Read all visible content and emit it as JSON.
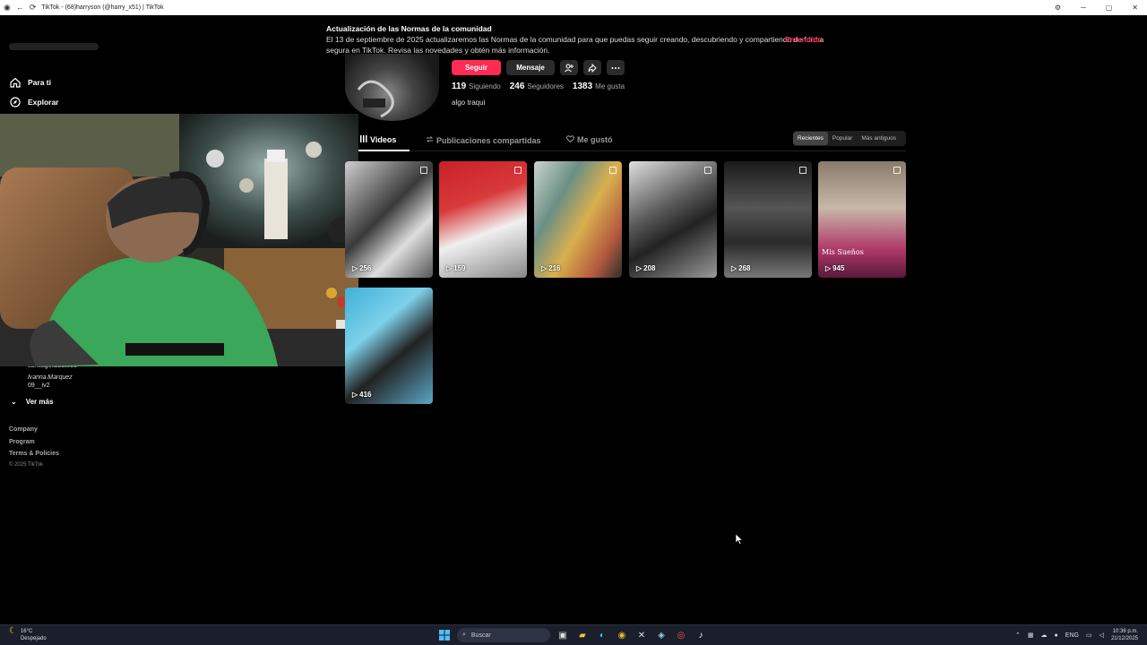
{
  "window": {
    "title": "TikTok - (68)harryson (@harry_x51) | TikTok",
    "nav_back": "←",
    "nav_reload": "⟳",
    "controls": [
      "⚙",
      "─",
      "▢",
      "✕"
    ]
  },
  "banner": {
    "title": "Actualización de las Normas de la comunidad",
    "text": "El 13 de septiembre de 2025 actualizaremos las Normas de la comunidad para que puedas seguir creando, descubriendo y compartiendo de forma segura en TikTok. Revisa las novedades y obtén más información.",
    "ok_label": "Entendido"
  },
  "sidebar": {
    "items": [
      {
        "label": "Para ti",
        "icon": "home-icon"
      },
      {
        "label": "Explorar",
        "icon": "compass-icon"
      }
    ],
    "following": [
      "santiago.alzate83",
      "𝐼𝑣𝑎𝑛𝑛𝑎 𝑀𝑎𝑟𝑞𝑢𝑒𝑧",
      "09__iv2"
    ],
    "more_label": "Ver más",
    "footer_links": [
      "Company",
      "Program",
      "Terms & Policies"
    ],
    "copyright": "© 2025 TikTok"
  },
  "profile": {
    "follow_label": "Seguir",
    "message_label": "Mensaje",
    "following_count": "119",
    "following_label": "Siguiendo",
    "followers_count": "246",
    "followers_label": "Seguidores",
    "likes_count": "1383",
    "likes_label": "Me gusta",
    "bio": "algo traqui"
  },
  "tabs": [
    {
      "label": "Videos",
      "icon": "grid-icon"
    },
    {
      "label": "Publicaciones compartidas",
      "icon": "repost-icon"
    },
    {
      "label": "Me gustó",
      "icon": "heart-icon"
    }
  ],
  "sort": [
    "Recientes",
    "Popular",
    "Más antiguos"
  ],
  "videos": [
    {
      "views": "256"
    },
    {
      "views": "159"
    },
    {
      "views": "216"
    },
    {
      "views": "208"
    },
    {
      "views": "268"
    },
    {
      "views": "945",
      "caption": "Mis Sueños"
    },
    {
      "views": "416"
    }
  ],
  "taskbar": {
    "temp": "16°C",
    "weather": "Despejado",
    "search_placeholder": "Buscar",
    "lang": "ENG",
    "time": "10:36 p.m.",
    "date": "21/12/2025"
  },
  "colors": {
    "accent": "#fe2c55",
    "background": "#000000",
    "taskbar": "#1b1f2b"
  }
}
